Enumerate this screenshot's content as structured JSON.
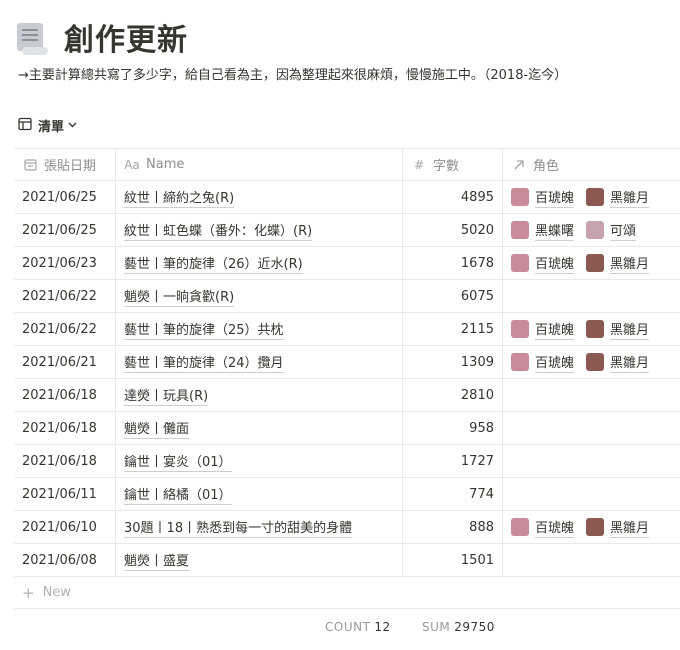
{
  "page": {
    "title": "創作更新",
    "description": "→主要計算總共寫了多少字，給自己看為主，因為整理起來很麻煩，慢慢施工中。（2018-迄今）"
  },
  "view": {
    "label": "清單"
  },
  "columns": {
    "date": "張貼日期",
    "name": "Name",
    "count": "字數",
    "roles": "角色"
  },
  "colors": {
    "avatar_a": "#c98a9a",
    "avatar_b": "#8a5a52",
    "avatar_c": "#c9a2b0"
  },
  "rows": [
    {
      "date": "2021/06/25",
      "name": "紋世丨締約之兔(R)",
      "count": "4895",
      "roles": [
        {
          "name": "百琥魄",
          "avatar": "avatar_a"
        },
        {
          "name": "黑雛月",
          "avatar": "avatar_b"
        }
      ]
    },
    {
      "date": "2021/06/25",
      "name": "紋世丨虹色蝶（番外：化蝶）(R)",
      "count": "5020",
      "roles": [
        {
          "name": "黑蝶曙",
          "avatar": "avatar_a"
        },
        {
          "name": "可頌",
          "avatar": "avatar_c"
        }
      ]
    },
    {
      "date": "2021/06/23",
      "name": "藝世丨筆的旋律（26）近水(R)",
      "count": "1678",
      "roles": [
        {
          "name": "百琥魄",
          "avatar": "avatar_a"
        },
        {
          "name": "黑雛月",
          "avatar": "avatar_b"
        }
      ]
    },
    {
      "date": "2021/06/22",
      "name": "魈熒丨一晌貪歡(R)",
      "count": "6075",
      "roles": []
    },
    {
      "date": "2021/06/22",
      "name": "藝世丨筆的旋律（25）共枕",
      "count": "2115",
      "roles": [
        {
          "name": "百琥魄",
          "avatar": "avatar_a"
        },
        {
          "name": "黑雛月",
          "avatar": "avatar_b"
        }
      ]
    },
    {
      "date": "2021/06/21",
      "name": "藝世丨筆的旋律（24）攬月",
      "count": "1309",
      "roles": [
        {
          "name": "百琥魄",
          "avatar": "avatar_a"
        },
        {
          "name": "黑雛月",
          "avatar": "avatar_b"
        }
      ]
    },
    {
      "date": "2021/06/18",
      "name": "達熒丨玩具(R)",
      "count": "2810",
      "roles": []
    },
    {
      "date": "2021/06/18",
      "name": "魈熒丨儺面",
      "count": "958",
      "roles": []
    },
    {
      "date": "2021/06/18",
      "name": "鑰世丨宴炎（01）",
      "count": "1727",
      "roles": []
    },
    {
      "date": "2021/06/11",
      "name": "鑰世丨絡橘（01）",
      "count": "774",
      "roles": []
    },
    {
      "date": "2021/06/10",
      "name": "30題丨18丨熟悉到每一寸的甜美的身體",
      "count": "888",
      "roles": [
        {
          "name": "百琥魄",
          "avatar": "avatar_a"
        },
        {
          "name": "黑雛月",
          "avatar": "avatar_b"
        }
      ]
    },
    {
      "date": "2021/06/08",
      "name": "魈熒丨盛夏",
      "count": "1501",
      "roles": []
    }
  ],
  "new_row": {
    "label": "New"
  },
  "footer": {
    "count_label": "COUNT",
    "count_value": "12",
    "sum_label": "SUM",
    "sum_value": "29750"
  }
}
